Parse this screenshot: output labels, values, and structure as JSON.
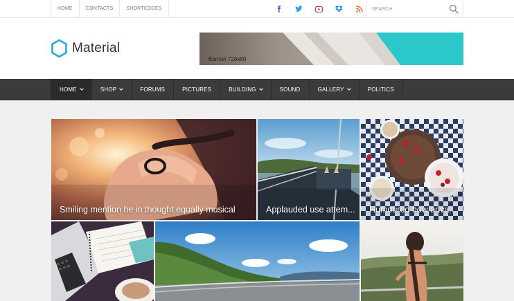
{
  "topbar": {
    "links": [
      "HOME",
      "CONTACTS",
      "SHORTCODES"
    ],
    "search_placeholder": "SEARCH"
  },
  "header": {
    "logo_text": "Material",
    "banner_label": "Banner 728x90"
  },
  "nav": {
    "items": [
      {
        "label": "HOME"
      },
      {
        "label": "SHOP"
      },
      {
        "label": "FORUMS"
      },
      {
        "label": "PICTURES"
      },
      {
        "label": "BUILDING"
      },
      {
        "label": "SOUND"
      },
      {
        "label": "GALLERY"
      },
      {
        "label": "POLITICS"
      }
    ]
  },
  "posts": [
    {
      "title": "Smiling mention he in thought equally musical"
    },
    {
      "title": "Applauded use attem..."
    },
    {
      "title": "Humoured how adva..."
    },
    {
      "title": ""
    },
    {
      "title": ""
    },
    {
      "title": ""
    }
  ],
  "colors": {
    "accent": "#29a8e0",
    "nav_bg": "#3b3b3b",
    "banner_teal": "#2cc7c9"
  }
}
